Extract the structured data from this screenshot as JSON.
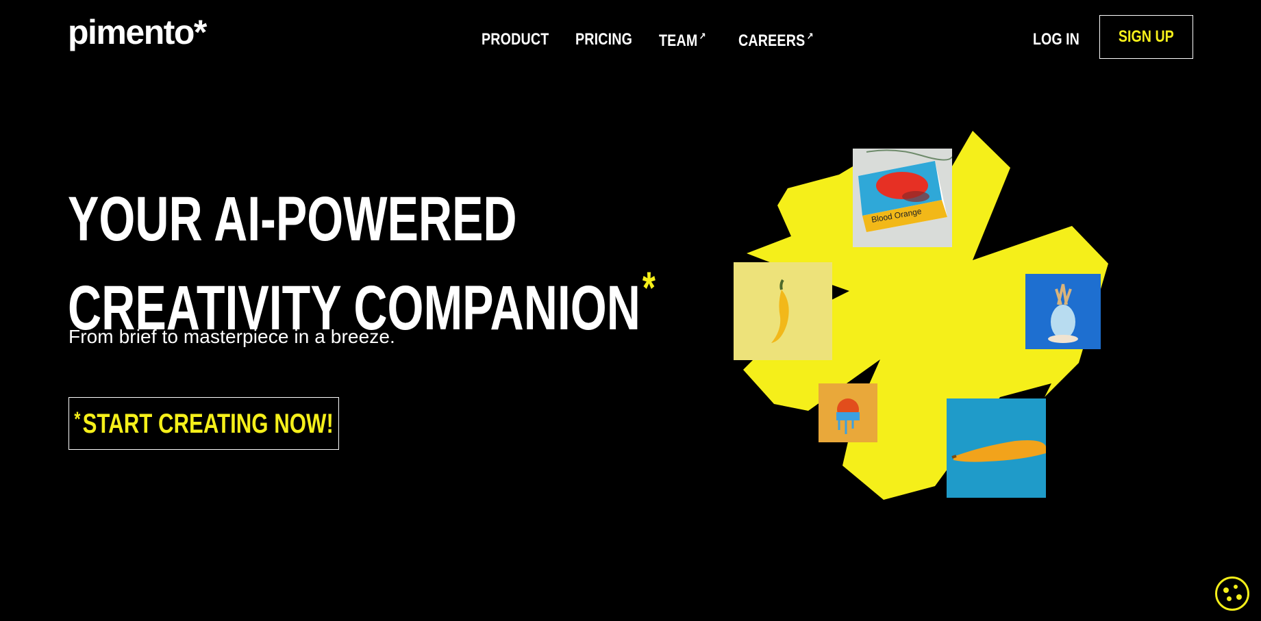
{
  "brand": {
    "logo_text": "pimento*",
    "accent_color": "#f5ef1a",
    "background_color": "#000000"
  },
  "nav": {
    "items": [
      {
        "label": "PRODUCT",
        "external": false
      },
      {
        "label": "PRICING",
        "external": false
      },
      {
        "label": "TEAM",
        "external": true
      },
      {
        "label": "CAREERS",
        "external": true
      }
    ],
    "external_icon": "external-link-arrow-icon"
  },
  "auth": {
    "login_label": "LOG IN",
    "signup_label": "SIGN UP"
  },
  "hero": {
    "title_line1": "YOUR AI-POWERED",
    "title_line2": "CREATIVITY COMPANION",
    "title_asterisk": "*",
    "subtitle": "From brief to masterpiece in a breeze.",
    "cta_asterisk": "*",
    "cta_label": "START CREATING NOW!"
  },
  "illustration": {
    "shape_icon": "yellow-starburst-shape",
    "tiles": [
      {
        "name": "blood-orange-book-image",
        "caption": "Blood Orange"
      },
      {
        "name": "yellow-chili-pepper-image"
      },
      {
        "name": "blue-pineapple-image"
      },
      {
        "name": "pumpkin-image"
      },
      {
        "name": "banana-image"
      }
    ]
  },
  "cookie": {
    "icon": "cookie-icon"
  }
}
